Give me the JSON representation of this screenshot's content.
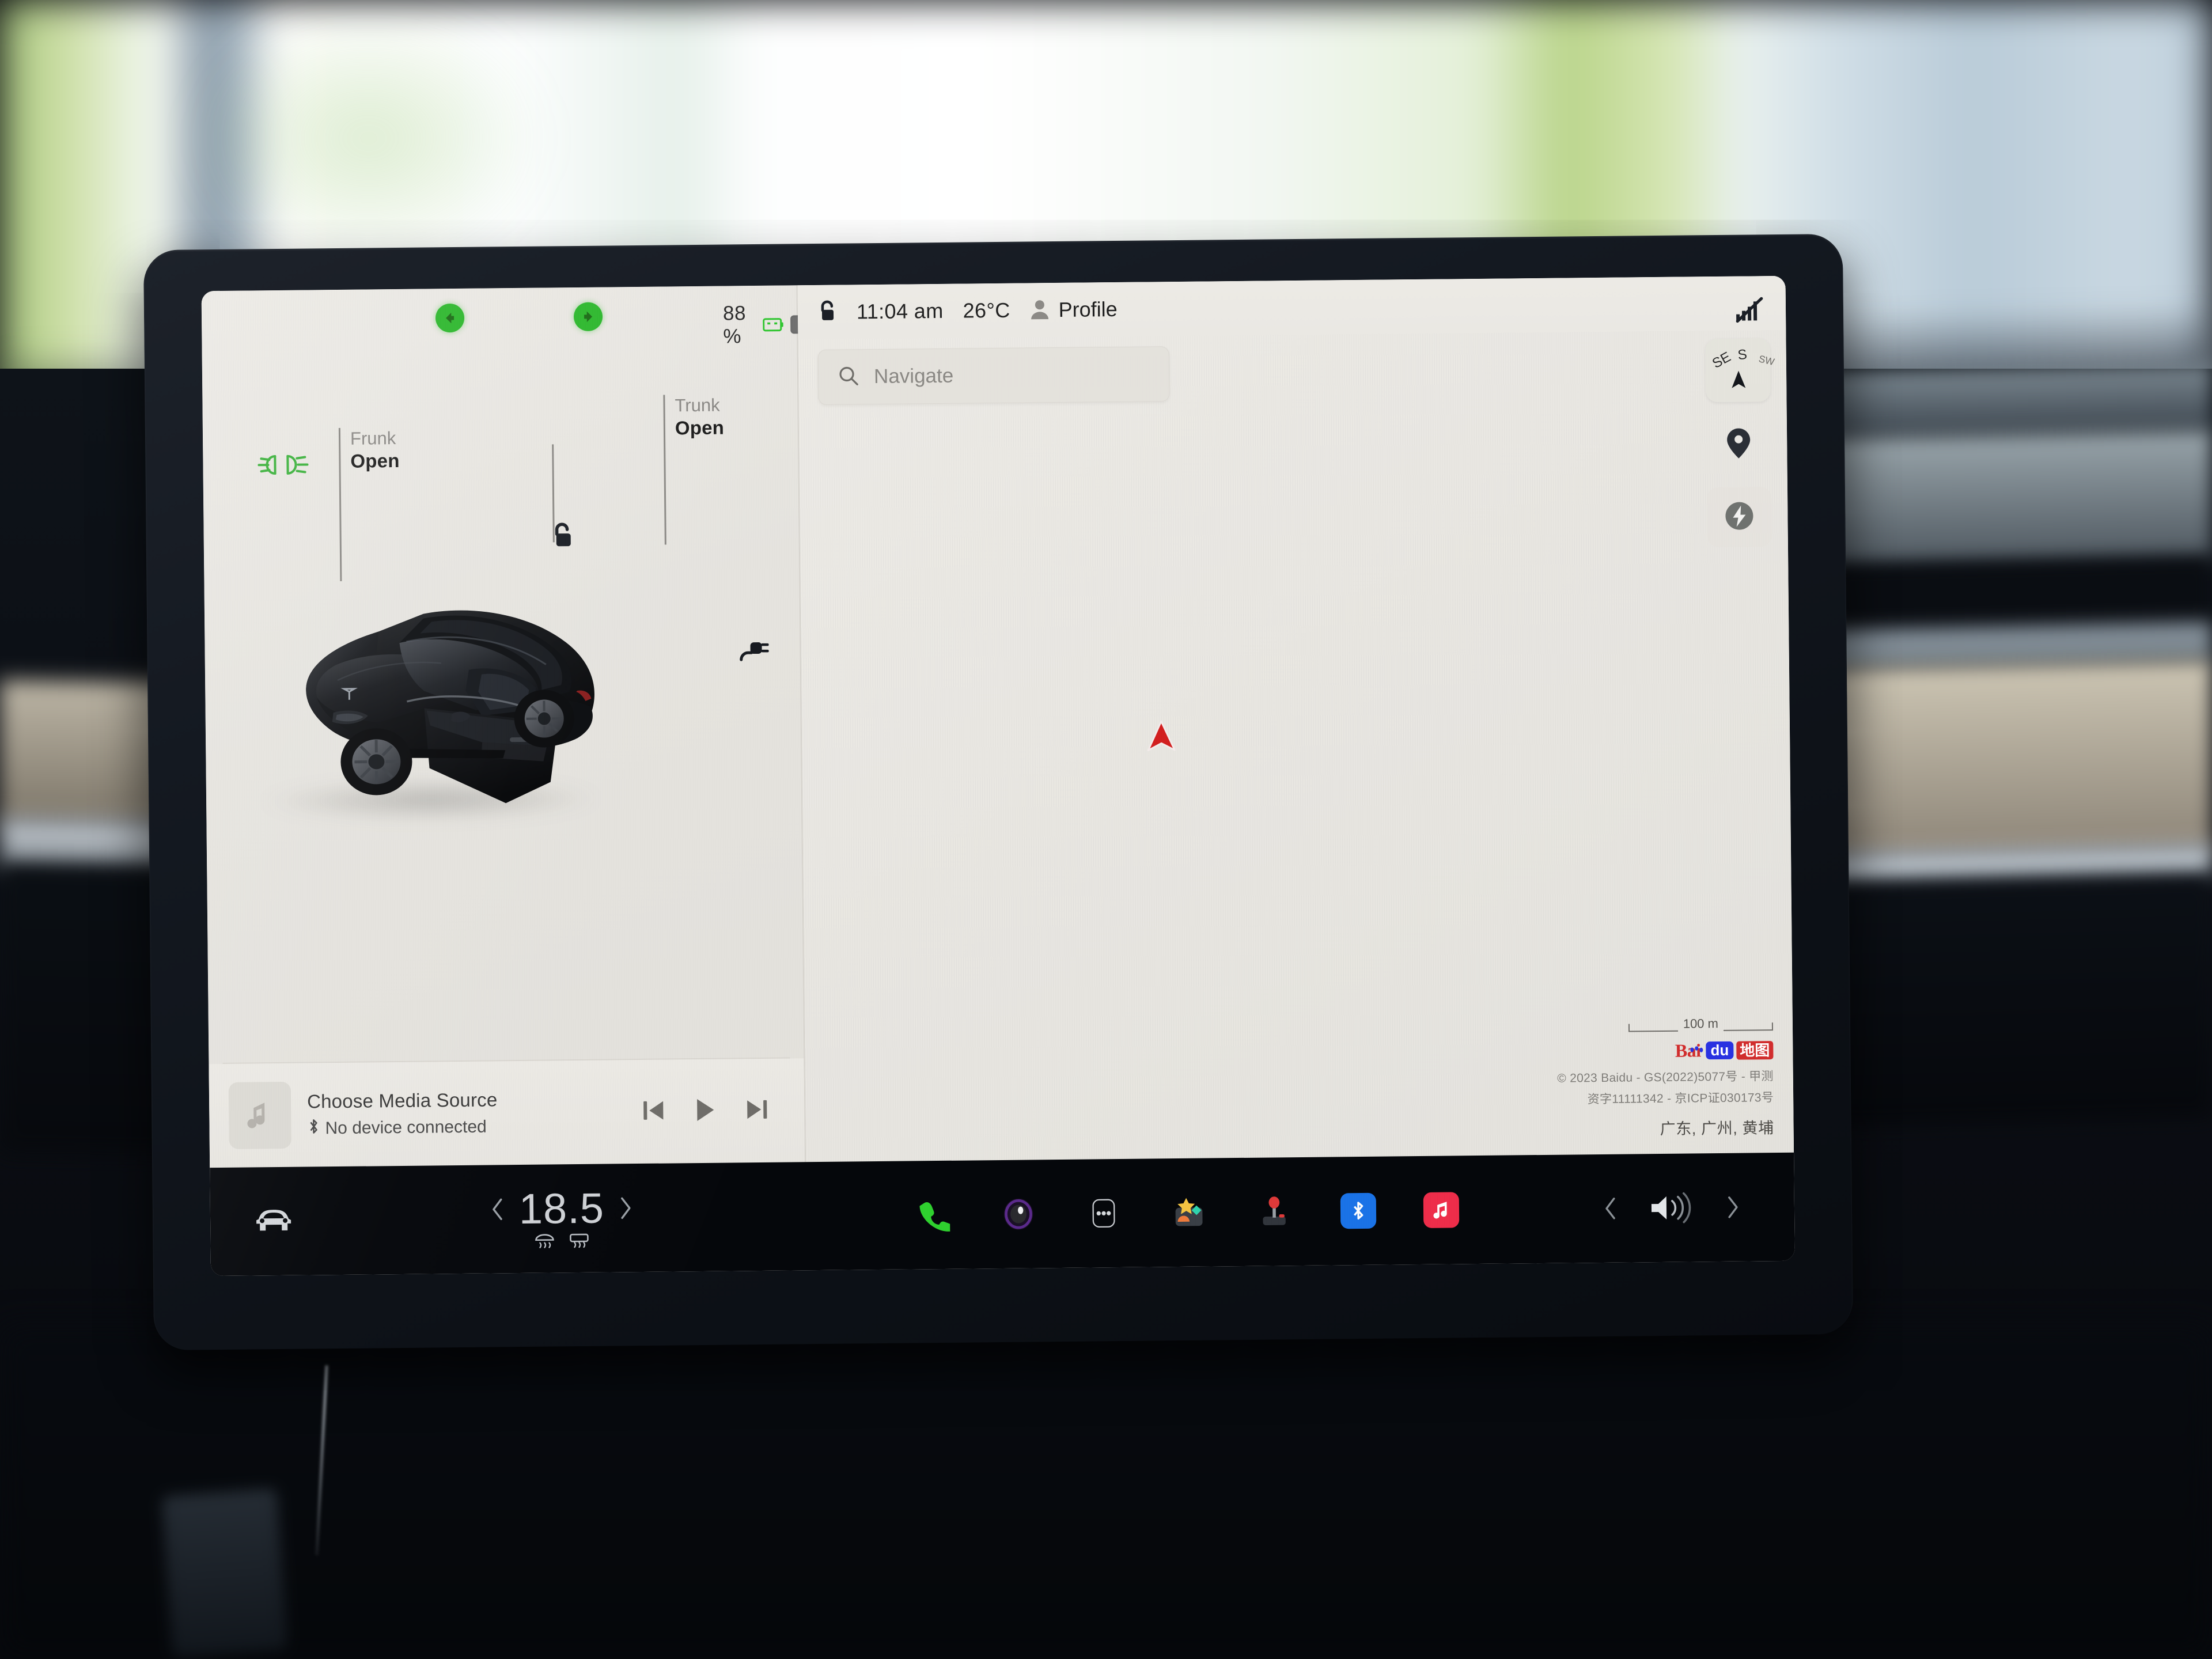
{
  "status_bar": {
    "battery_percent": "88 %",
    "battery_icon": "battery-icon",
    "green_battery_icon": "green-battery-icon",
    "lock_icon": "lock-open-icon",
    "clock": "11:04 am",
    "temperature": "26°C",
    "profile_icon": "person-icon",
    "profile_label": "Profile",
    "turn_signal_left_icon": "turn-signal-left-icon",
    "turn_signal_right_icon": "turn-signal-right-icon"
  },
  "car_panel": {
    "lights_indicator_icon": "parking-lights-icon",
    "unlock_icon": "lock-open-icon",
    "charge_port_icon": "charge-plug-icon",
    "callouts": [
      {
        "title": "Frunk",
        "state": "Open"
      },
      {
        "title": "Trunk",
        "state": "Open"
      }
    ],
    "vehicle_image": "tesla-model-y-black"
  },
  "media": {
    "album_art_icon": "music-note-icon",
    "title": "Choose Media Source",
    "bluetooth_icon": "bluetooth-icon",
    "subtitle": "No device connected",
    "controls": {
      "previous_icon": "skip-previous-icon",
      "play_icon": "play-icon",
      "next_icon": "skip-next-icon"
    }
  },
  "map": {
    "search": {
      "icon": "search-icon",
      "placeholder": "Navigate"
    },
    "signal_icon": "no-cellular-signal-icon",
    "compass": {
      "label_se": "SE",
      "label_s": "S",
      "label_sw": "SW",
      "arrow_icon": "compass-north-arrow-icon"
    },
    "recenter_icon": "location-pin-icon",
    "charging_icon": "charging-bolt-icon",
    "vehicle_marker_icon": "navigation-arrow-icon",
    "vehicle_marker_color": "#d31f1f",
    "scale_label": "100 m",
    "provider": {
      "bai": "Bai",
      "du": "du",
      "ditu": "地图"
    },
    "attribution_line_1": "© 2023 Baidu - GS(2022)5077号 - 甲测",
    "attribution_line_2": "资字11111342 - 京ICP证030173号",
    "location": "广东, 广州, 黄埔"
  },
  "taskbar": {
    "car_icon": "car-front-icon",
    "climate": {
      "decrease_icon": "chevron-left-icon",
      "temperature": "18.5",
      "increase_icon": "chevron-right-icon",
      "defrost_front_icon": "defrost-front-icon",
      "defrost_rear_icon": "defrost-rear-icon"
    },
    "apps": [
      {
        "name": "phone-app-icon",
        "color": "#2fd12f"
      },
      {
        "name": "dashcam-app-icon",
        "color": "#5b2a8c"
      },
      {
        "name": "more-apps-icon",
        "color": "#d8d8d8"
      },
      {
        "name": "toybox-app-icon",
        "color": "#f5c542"
      },
      {
        "name": "arcade-app-icon",
        "color": "#e03a3a"
      },
      {
        "name": "bluetooth-app-icon",
        "color": "#1a73e8"
      },
      {
        "name": "music-app-icon",
        "color": "#ef2d4a"
      }
    ],
    "volume": {
      "decrease_icon": "chevron-left-icon",
      "speaker_icon": "volume-speaker-icon",
      "increase_icon": "chevron-right-icon"
    }
  }
}
